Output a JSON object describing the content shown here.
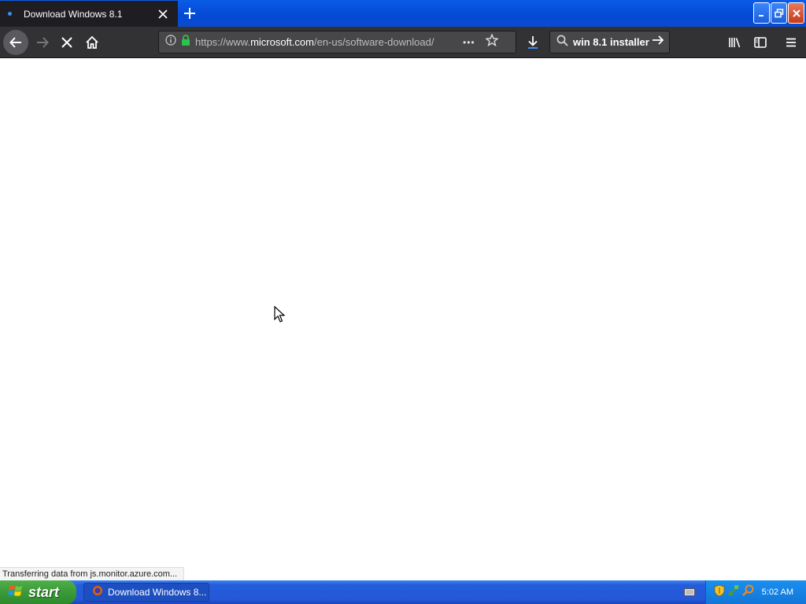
{
  "window": {
    "tab_title": "Download Windows 8.1",
    "new_tab_label": "+"
  },
  "toolbar": {
    "url_prefix": "https://www.",
    "url_domain": "microsoft.com",
    "url_path": "/en-us/software-download/",
    "page_actions": "•••",
    "search_query": "win 8.1 installer"
  },
  "status_bar": {
    "text": "Transferring data from js.monitor.azure.com..."
  },
  "taskbar": {
    "start_label": "start",
    "task_label": "Download Windows 8...",
    "clock": "5:02 AM"
  },
  "colors": {
    "titlebar": "#0548d4",
    "toolbar": "#323234",
    "lock_green": "#2fc24a",
    "start_green": "#3a9a38"
  }
}
